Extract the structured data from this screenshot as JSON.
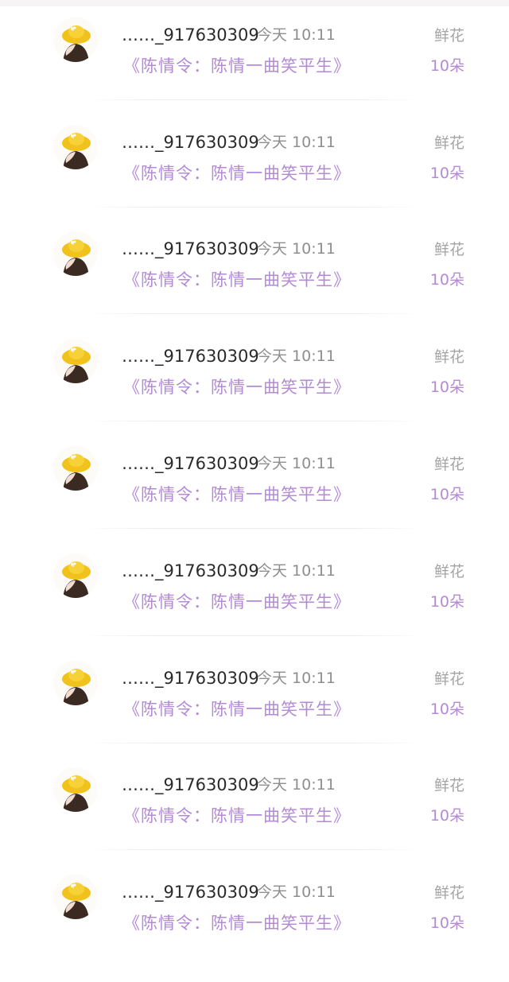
{
  "records": [
    {
      "username": "……_917630309",
      "time": "今天 10:11",
      "title": "《陈情令：陈情一曲笑平生》",
      "gift_name": "鲜花",
      "gift_count": "10朵"
    },
    {
      "username": "……_917630309",
      "time": "今天 10:11",
      "title": "《陈情令：陈情一曲笑平生》",
      "gift_name": "鲜花",
      "gift_count": "10朵"
    },
    {
      "username": "……_917630309",
      "time": "今天 10:11",
      "title": "《陈情令：陈情一曲笑平生》",
      "gift_name": "鲜花",
      "gift_count": "10朵"
    },
    {
      "username": "……_917630309",
      "time": "今天 10:11",
      "title": "《陈情令：陈情一曲笑平生》",
      "gift_name": "鲜花",
      "gift_count": "10朵"
    },
    {
      "username": "……_917630309",
      "time": "今天 10:11",
      "title": "《陈情令：陈情一曲笑平生》",
      "gift_name": "鲜花",
      "gift_count": "10朵"
    },
    {
      "username": "……_917630309",
      "time": "今天 10:11",
      "title": "《陈情令：陈情一曲笑平生》",
      "gift_name": "鲜花",
      "gift_count": "10朵"
    },
    {
      "username": "……_917630309",
      "time": "今天 10:11",
      "title": "《陈情令：陈情一曲笑平生》",
      "gift_name": "鲜花",
      "gift_count": "10朵"
    },
    {
      "username": "……_917630309",
      "time": "今天 10:11",
      "title": "《陈情令：陈情一曲笑平生》",
      "gift_name": "鲜花",
      "gift_count": "10朵"
    },
    {
      "username": "……_917630309",
      "time": "今天 10:11",
      "title": "《陈情令：陈情一曲笑平生》",
      "gift_name": "鲜花",
      "gift_count": "10朵"
    }
  ],
  "avatar_icon": "girl-yellow-hat-avatar",
  "colors": {
    "accent_purple": "#b38ad4",
    "username": "#2a2a2a",
    "secondary": "#8e8e8e",
    "gift_label": "#a4a4a4"
  }
}
